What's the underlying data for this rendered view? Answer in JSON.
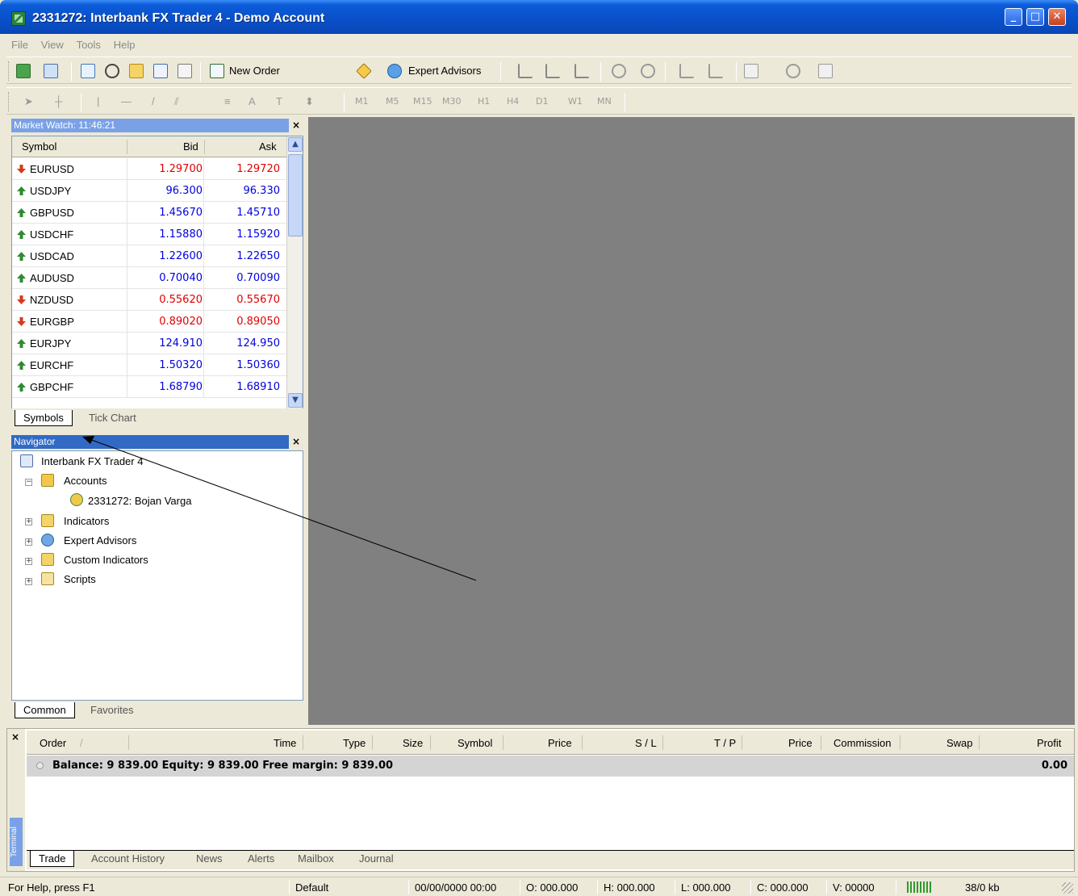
{
  "window": {
    "title": "2331272: Interbank FX Trader 4 - Demo Account"
  },
  "menu": [
    "File",
    "View",
    "Tools",
    "Help"
  ],
  "toolbar": {
    "new_order": "New Order",
    "expert_advisors": "Expert Advisors",
    "timeframes": [
      "M1",
      "M5",
      "M15",
      "M30",
      "H1",
      "H4",
      "D1",
      "W1",
      "MN"
    ]
  },
  "market_watch": {
    "title": "Market Watch: 11:46:21",
    "columns": [
      "Symbol",
      "Bid",
      "Ask"
    ],
    "rows": [
      {
        "symbol": "EURUSD",
        "bid": "1.29700",
        "ask": "1.29720",
        "dir": "down"
      },
      {
        "symbol": "USDJPY",
        "bid": "96.300",
        "ask": "96.330",
        "dir": "up"
      },
      {
        "symbol": "GBPUSD",
        "bid": "1.45670",
        "ask": "1.45710",
        "dir": "up"
      },
      {
        "symbol": "USDCHF",
        "bid": "1.15880",
        "ask": "1.15920",
        "dir": "up"
      },
      {
        "symbol": "USDCAD",
        "bid": "1.22600",
        "ask": "1.22650",
        "dir": "up"
      },
      {
        "symbol": "AUDUSD",
        "bid": "0.70040",
        "ask": "0.70090",
        "dir": "up"
      },
      {
        "symbol": "NZDUSD",
        "bid": "0.55620",
        "ask": "0.55670",
        "dir": "down"
      },
      {
        "symbol": "EURGBP",
        "bid": "0.89020",
        "ask": "0.89050",
        "dir": "down"
      },
      {
        "symbol": "EURJPY",
        "bid": "124.910",
        "ask": "124.950",
        "dir": "up"
      },
      {
        "symbol": "EURCHF",
        "bid": "1.50320",
        "ask": "1.50360",
        "dir": "up"
      },
      {
        "symbol": "GBPCHF",
        "bid": "1.68790",
        "ask": "1.68910",
        "dir": "up"
      }
    ],
    "tabs": [
      "Symbols",
      "Tick Chart"
    ]
  },
  "navigator": {
    "title": "Navigator",
    "root": "Interbank FX Trader 4",
    "accounts": "Accounts",
    "account_item": "2331272: Bojan Varga",
    "indicators": "Indicators",
    "expert_advisors": "Expert Advisors",
    "custom_indicators": "Custom Indicators",
    "scripts": "Scripts",
    "tabs": [
      "Common",
      "Favorites"
    ]
  },
  "terminal": {
    "side_label": "Terminal",
    "columns": [
      "Order",
      "Time",
      "Type",
      "Size",
      "Symbol",
      "Price",
      "S / L",
      "T / P",
      "Price",
      "Commission",
      "Swap",
      "Profit"
    ],
    "balance_text": "Balance: 9 839.00  Equity: 9 839.00  Free margin: 9 839.00",
    "profit": "0.00",
    "tabs": [
      "Trade",
      "Account History",
      "News",
      "Alerts",
      "Mailbox",
      "Journal"
    ]
  },
  "statusbar": {
    "help": "For Help, press F1",
    "profile": "Default",
    "datetime": "00/00/0000 00:00",
    "open": "O: 000.000",
    "high": "H: 000.000",
    "low": "L: 000.000",
    "close": "C: 000.000",
    "volume": "V: 00000",
    "traffic": "38/0 kb"
  },
  "colors": {
    "up": "#0000e0",
    "down": "#e00000",
    "header_active": "#316ac5",
    "chart_bg": "#808080"
  }
}
